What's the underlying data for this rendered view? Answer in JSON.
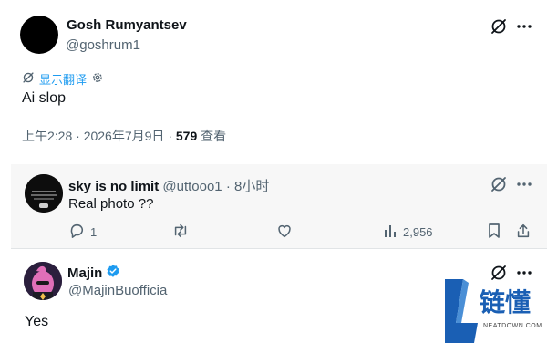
{
  "main_tweet": {
    "author_name": "Gosh Rumyantsev",
    "author_handle": "@goshrum1",
    "translate_label": "显示翻译",
    "text": "Ai slop",
    "time": "上午2:28",
    "date": "2026年7月9日",
    "separator": "·",
    "view_count": "579",
    "views_label": "查看"
  },
  "reply": {
    "author_name": "sky is no limit",
    "author_handle": "@uttooo1",
    "separator": "·",
    "age": "8小时",
    "text": "Real photo ??",
    "reply_count": "1",
    "view_count": "2,956"
  },
  "third_tweet": {
    "author_name": "Majin",
    "author_handle": "@MajinBuofficia",
    "text": "Yes"
  },
  "watermark": {
    "brand_text": "链懂",
    "brand_sub": "NEATDOWN.COM",
    "color": "#1a5fb4"
  },
  "icons": {
    "grok": "grok-icon",
    "more": "more-icon",
    "translate": "translate-icon",
    "settings": "gear-icon",
    "reply": "reply-icon",
    "retweet": "retweet-icon",
    "like": "heart-icon",
    "views": "views-icon",
    "bookmark": "bookmark-icon",
    "share": "share-icon",
    "verified": "verified-badge-icon"
  },
  "colors": {
    "accent": "#1d9bf0",
    "muted": "#536471",
    "text": "#0f1419"
  }
}
